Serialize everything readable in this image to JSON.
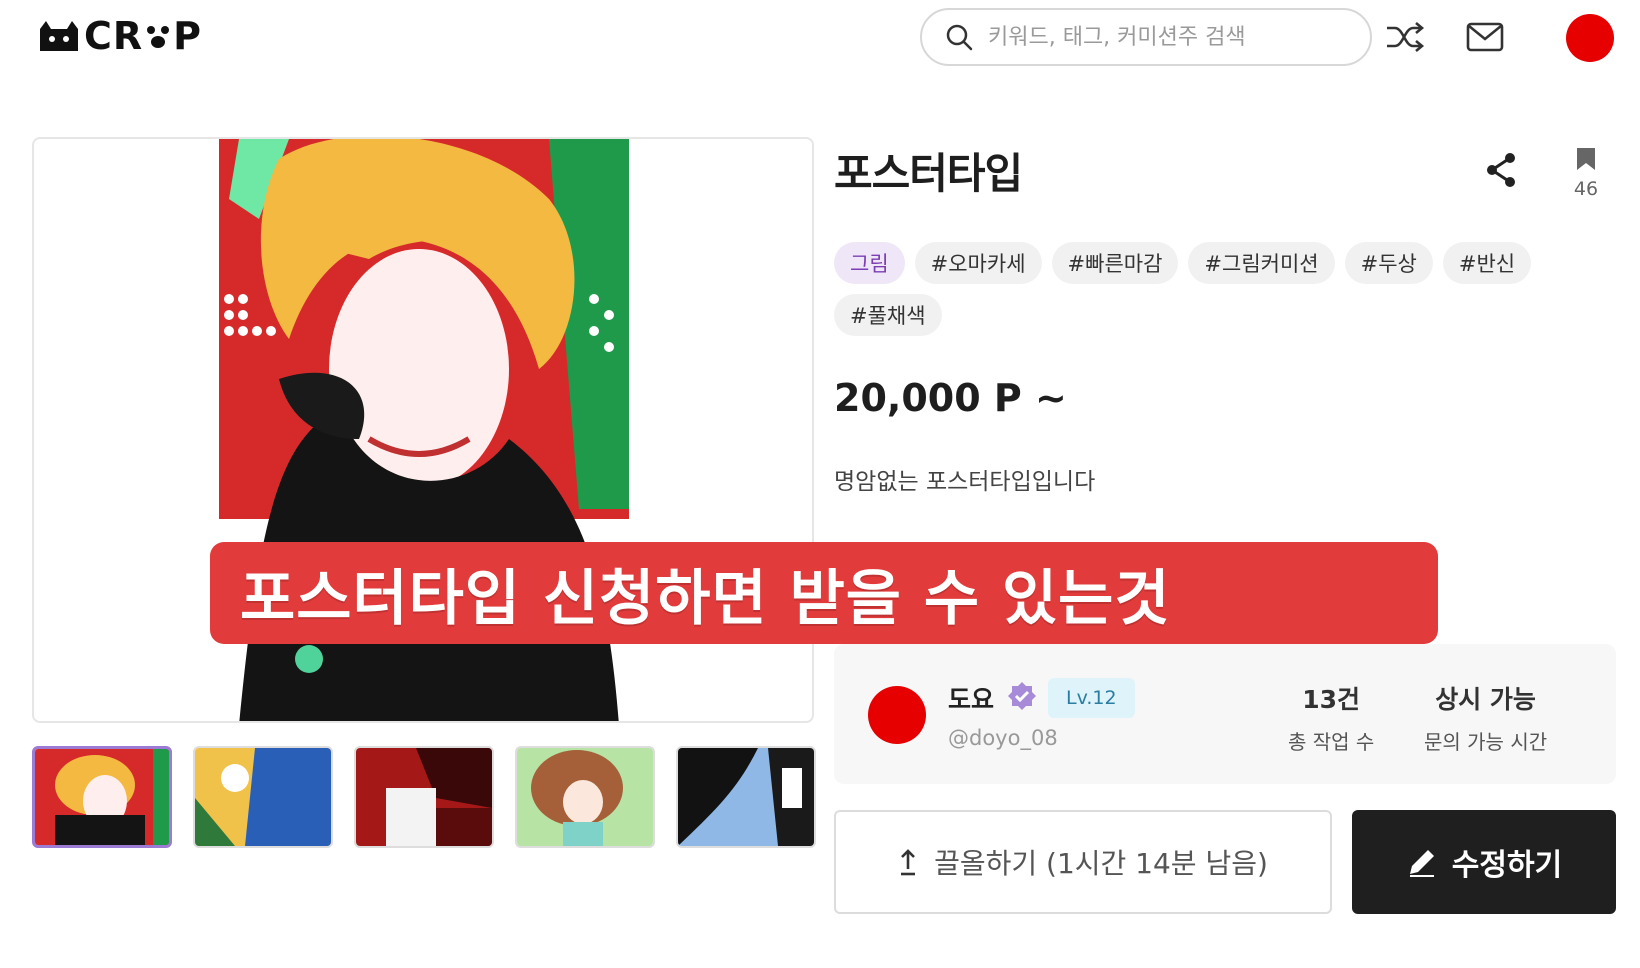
{
  "header": {
    "logo_text": "CR P",
    "search_placeholder": "키워드, 태그, 커미션주 검색"
  },
  "product": {
    "title": "포스터타입",
    "bookmark_count": "46",
    "tags": [
      "그림",
      "#오마카세",
      "#빠른마감",
      "#그림커미션",
      "#두상",
      "#반신",
      "#풀채색"
    ],
    "price": "20,000 P ~",
    "description": "명암없는 포스터타입입니다",
    "overlay_text": "포스터타입 신청하면 받을 수 있는것"
  },
  "seller": {
    "name": "도요",
    "level": "Lv.12",
    "handle": "@doyo_08",
    "stats": [
      {
        "value": "13건",
        "label": "총 작업 수"
      },
      {
        "value": "상시 가능",
        "label": "문의 가능 시간"
      }
    ]
  },
  "actions": {
    "bump_label": "끌올하기 (1시간 14분 남음)",
    "edit_label": "수정하기"
  },
  "colors": {
    "accent_red": "#e23b3b",
    "avatar_red": "#e60000",
    "category_tag_text": "#7b3fb3",
    "level_badge_bg": "#dff3fb"
  }
}
